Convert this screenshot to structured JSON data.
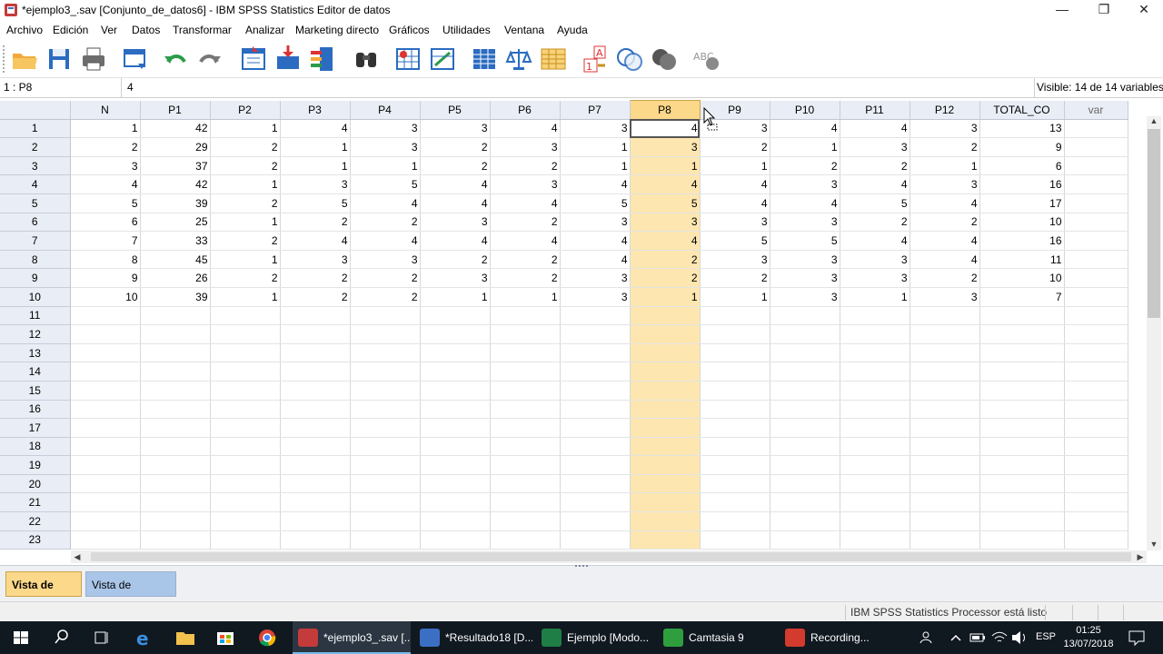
{
  "window": {
    "title": "*ejemplo3_.sav [Conjunto_de_datos6] - IBM SPSS Statistics Editor de datos",
    "minimize": "—",
    "restore": "❐",
    "close": "✕"
  },
  "menu": [
    "Archivo",
    "Edición",
    "Ver",
    "Datos",
    "Transformar",
    "Analizar",
    "Marketing directo",
    "Gráficos",
    "Utilidades",
    "Ventana",
    "Ayuda"
  ],
  "toolbar_icons": [
    "open-folder-icon",
    "save-icon",
    "print-icon",
    "dialog-recall-icon",
    "undo-icon",
    "redo-icon",
    "goto-case-icon",
    "goto-variable-icon",
    "variables-icon",
    "find-icon",
    "insert-cases-icon",
    "insert-variable-icon",
    "split-file-icon",
    "weight-cases-icon",
    "select-cases-icon",
    "value-labels-icon",
    "use-variable-sets-icon",
    "show-all-variables-icon",
    "spell-check-icon"
  ],
  "editor": {
    "cell_ref": "1 : P8",
    "cell_value": "4",
    "visible": "Visible: 14 de 14 variables"
  },
  "columns": [
    "N",
    "P1",
    "P2",
    "P3",
    "P4",
    "P5",
    "P6",
    "P7",
    "P8",
    "P9",
    "P10",
    "P11",
    "P12",
    "TOTAL_CO",
    "var"
  ],
  "selected_column": "P8",
  "rows": [
    [
      1,
      42,
      1,
      4,
      3,
      3,
      4,
      3,
      4,
      3,
      4,
      4,
      3,
      13
    ],
    [
      2,
      29,
      2,
      1,
      3,
      2,
      3,
      1,
      3,
      2,
      1,
      3,
      2,
      9
    ],
    [
      3,
      37,
      2,
      1,
      1,
      2,
      2,
      1,
      1,
      1,
      2,
      2,
      1,
      6
    ],
    [
      4,
      42,
      1,
      3,
      5,
      4,
      3,
      4,
      4,
      4,
      3,
      4,
      3,
      16
    ],
    [
      5,
      39,
      2,
      5,
      4,
      4,
      4,
      5,
      5,
      4,
      4,
      5,
      4,
      17
    ],
    [
      6,
      25,
      1,
      2,
      2,
      3,
      2,
      3,
      3,
      3,
      3,
      2,
      2,
      10
    ],
    [
      7,
      33,
      2,
      4,
      4,
      4,
      4,
      4,
      4,
      5,
      5,
      4,
      4,
      16
    ],
    [
      8,
      45,
      1,
      3,
      3,
      2,
      2,
      4,
      2,
      3,
      3,
      3,
      4,
      11
    ],
    [
      9,
      26,
      2,
      2,
      2,
      3,
      2,
      3,
      2,
      2,
      3,
      3,
      2,
      10
    ],
    [
      10,
      39,
      1,
      2,
      2,
      1,
      1,
      3,
      1,
      1,
      3,
      1,
      3,
      7
    ]
  ],
  "row_count": 23,
  "tabs": {
    "data_view": "Vista de datos",
    "variable_view": "Vista de variables"
  },
  "status": "IBM SPSS Statistics Processor está listo",
  "taskbar": {
    "tasks": [
      {
        "label": "*ejemplo3_.sav [...",
        "color": "#c43b3b"
      },
      {
        "label": "*Resultado18 [D...",
        "color": "#3b6fc4"
      },
      {
        "label": "Ejemplo  [Modo...",
        "color": "#1e7e45"
      },
      {
        "label": "Camtasia 9",
        "color": "#2e9e3e"
      },
      {
        "label": "Recording...",
        "color": "#d23b2e"
      }
    ],
    "language": "ESP",
    "time": "01:25",
    "date": "13/07/2018"
  },
  "colors": {
    "selected_header": "#fbd88a",
    "selected_column": "#fde6b0",
    "header": "#e9edf5"
  }
}
